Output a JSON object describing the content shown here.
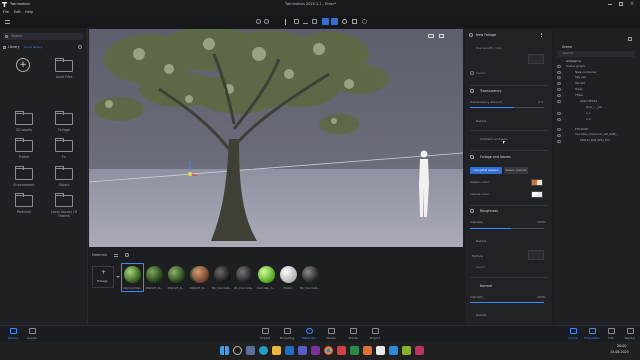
{
  "app": {
    "name": "Twinmotion",
    "title": "Twinmotion 2025.1.1 - Enter*"
  },
  "menu": [
    "File",
    "Edit",
    "Help"
  ],
  "left": {
    "search_placeholder": "Search",
    "library_label": "Library",
    "library_crumb": "Local library",
    "tiles": [
      "",
      "Local Files",
      "3D assets",
      "Foliage",
      "Frame",
      "Fx",
      "Environment",
      "Object",
      "Particles",
      "Local Library Of Fabrics"
    ]
  },
  "bottom": {
    "title": "Materials",
    "add_label": "Foliage",
    "swatches": [
      {
        "label": "Normal Map",
        "color": "#4a7a2a"
      },
      {
        "label": "RS0123_R...",
        "color": "#2e4f1b"
      },
      {
        "label": "RS0123_R...",
        "color": "#3a5a22"
      },
      {
        "label": "RS0123_R...",
        "color": "#2a3f1a"
      },
      {
        "label": "RS0123_R...",
        "color": "#8c5a3c"
      },
      {
        "label": "RS_Concrete...",
        "color": "#2b2b2e"
      },
      {
        "label": "RS_Concrete...",
        "color": "#3a3a3e"
      },
      {
        "label": "Concrete_S...",
        "color": "#7ad02a"
      },
      {
        "label": "Plastic",
        "color": "#e0e0e0"
      },
      {
        "label": "RS_Concrete...",
        "color": "#4a4a4e"
      }
    ]
  },
  "props": {
    "name": "New Foliage",
    "sub1": "Use specific map",
    "sub2": "Invert",
    "translucency": "Translucency",
    "trans_label": "Translucency amount",
    "trans_value": "0.3",
    "trans_fraction": 0.6,
    "details": "Details",
    "ambient": "Ambient occlusion",
    "foliage_section": "Foliage and leaves",
    "btn1": "Use global seasons",
    "btn2": "Season override",
    "season_color": "Season color",
    "leaves_color": "Leaves color",
    "roughness": "Roughness",
    "intensity": "Intensity",
    "intensity_value": "100%",
    "intensity_fraction": 0.55,
    "details2": "Details",
    "texture_label": "Texture",
    "invert2": "Invert",
    "normal": "Normal",
    "normal_intensity": "Intensity",
    "normal_value": "100%",
    "normal_fraction": 1.0,
    "details3": "Details"
  },
  "scene": {
    "title": "Scene",
    "search": "Search",
    "items": [
      "Ambience",
      "Scene graph",
      "New container",
      "Sky set",
      "Terrain",
      "Trees",
      "Tfiles",
      "ASD-HET02",
      "Unk_..._Jun",
      "1.1",
      "1.2",
      "FOLIAGE",
      "Cascades_component_veh_XWB_...",
      "RS0123_RGE_RF04_Fb4"
    ]
  },
  "bottombar": {
    "left": [
      "Library",
      "Assets"
    ],
    "center": [
      "Import",
      "Modelling",
      "Materials",
      "Media",
      "Plants",
      "Export"
    ],
    "right": [
      "Scene",
      "Properties",
      "Info",
      "Render"
    ]
  },
  "clock": {
    "time": "20:00",
    "date": "15.08.2025"
  }
}
